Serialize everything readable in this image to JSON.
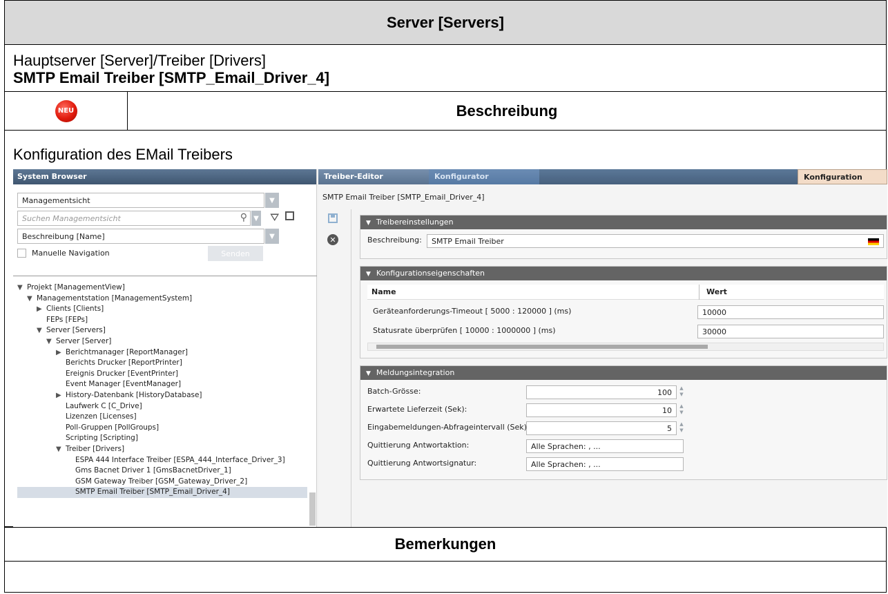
{
  "doc": {
    "title": "Server [Servers]",
    "path": "Hauptserver [Server]/Treiber [Drivers]",
    "object": "SMTP Email Treiber [SMTP_Email_Driver_4]",
    "badge": "NEU",
    "description_head": "Beschreibung",
    "description": "Konfiguration des EMail Treibers",
    "remarks_head": "Bemerkungen",
    "remarks": ""
  },
  "browser": {
    "title": "System Browser",
    "view_select": "Managementsicht",
    "search_placeholder": "Suchen Managementsicht",
    "name_select": "Beschreibung [Name]",
    "manual_nav": "Manuelle Navigation",
    "send_button": "Senden",
    "tree": [
      {
        "label": "Projekt [ManagementView]",
        "twisty": "▼"
      },
      {
        "label": "Managementstation [ManagementSystem]",
        "twisty": "▼"
      },
      {
        "label": "Clients [Clients]",
        "twisty": "▶"
      },
      {
        "label": "FEPs [FEPs]",
        "twisty": ""
      },
      {
        "label": "Server [Servers]",
        "twisty": "▼"
      },
      {
        "label": "Server [Server]",
        "twisty": "▼"
      },
      {
        "label": "Berichtmanager [ReportManager]",
        "twisty": "▶"
      },
      {
        "label": "Berichts Drucker [ReportPrinter]",
        "twisty": ""
      },
      {
        "label": "Ereignis Drucker [EventPrinter]",
        "twisty": ""
      },
      {
        "label": "Event Manager [EventManager]",
        "twisty": ""
      },
      {
        "label": "History-Datenbank [HistoryDatabase]",
        "twisty": "▶"
      },
      {
        "label": "Laufwerk C [C_Drive]",
        "twisty": ""
      },
      {
        "label": "Lizenzen [Licenses]",
        "twisty": ""
      },
      {
        "label": "Poll-Gruppen [PollGroups]",
        "twisty": ""
      },
      {
        "label": "Scripting [Scripting]",
        "twisty": ""
      },
      {
        "label": "Treiber [Drivers]",
        "twisty": "▼"
      },
      {
        "label": "ESPA 444 Interface Treiber [ESPA_444_Interface_Driver_3]",
        "twisty": ""
      },
      {
        "label": "Gms Bacnet Driver 1 [GmsBacnetDriver_1]",
        "twisty": ""
      },
      {
        "label": "GSM Gateway Treiber [GSM_Gateway_Driver_2]",
        "twisty": ""
      },
      {
        "label": "SMTP Email Treiber [SMTP_Email_Driver_4]",
        "twisty": ""
      }
    ]
  },
  "editor": {
    "tab1": "Treiber-Editor",
    "tab2": "Konfigurator",
    "tab3": "Konfiguration",
    "title": "SMTP Email Treiber [SMTP_Email_Driver_4]",
    "p1_title": "Treibereinstellungen",
    "p1_label": "Beschreibung:",
    "p1_value": "SMTP Email Treiber",
    "p2_title": "Konfigurationseigenschaften",
    "col_name": "Name",
    "col_value": "Wert",
    "row1_name": "Geräteanforderungs-Timeout [ 5000 : 120000 ]  (ms)",
    "row1_value": "10000",
    "row2_name": "Statusrate überprüfen [ 10000 : 1000000 ]  (ms)",
    "row2_value": "30000",
    "p3_title": "Meldungsintegration",
    "batch_label": "Batch-Grösse:",
    "batch_value": "100",
    "delivery_label": "Erwartete Lieferzeit (Sek):",
    "delivery_value": "10",
    "poll_label": "Eingabemeldungen-Abfrageintervall (Sek):",
    "poll_value": "5",
    "ack_action_label": "Quittierung Antwortaktion:",
    "ack_action_value": "Alle Sprachen: , ...",
    "ack_sig_label": "Quittierung Antwortsignatur:",
    "ack_sig_value": "Alle Sprachen: , ..."
  }
}
